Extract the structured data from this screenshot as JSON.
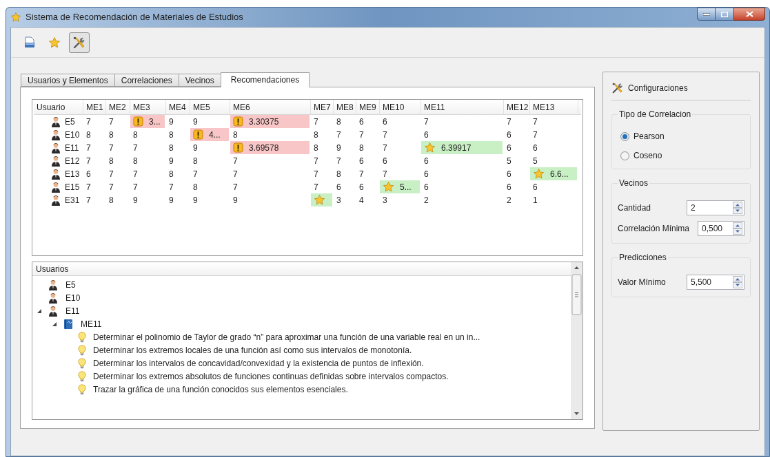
{
  "window": {
    "title": "Sistema de Recomendación de Materiales de Estudios"
  },
  "toolbar": {
    "buttons": [
      {
        "kind": "document",
        "selected": false
      },
      {
        "kind": "star",
        "selected": false
      },
      {
        "kind": "tools",
        "selected": true
      }
    ]
  },
  "tabs": [
    {
      "label": "Usuarios y Elementos",
      "selected": false
    },
    {
      "label": "Correlaciones",
      "selected": false
    },
    {
      "label": "Vecinos",
      "selected": false
    },
    {
      "label": "Recomendaciones",
      "selected": true
    }
  ],
  "table": {
    "columns": [
      "Usuario",
      "ME1",
      "ME2",
      "ME3",
      "ME4",
      "ME5",
      "ME6",
      "ME7",
      "ME8",
      "ME9",
      "ME10",
      "ME11",
      "ME12",
      "ME13"
    ],
    "rows": [
      {
        "cells": [
          {
            "kind": "user",
            "text": "E5"
          },
          {
            "kind": "value",
            "text": "7"
          },
          {
            "kind": "value",
            "text": "7"
          },
          {
            "kind": "warning",
            "text": "3..."
          },
          {
            "kind": "value",
            "text": "9"
          },
          {
            "kind": "value",
            "text": "9"
          },
          {
            "kind": "warning",
            "text": "3.30375"
          },
          {
            "kind": "value",
            "text": "7"
          },
          {
            "kind": "value",
            "text": "8"
          },
          {
            "kind": "value",
            "text": "6"
          },
          {
            "kind": "value",
            "text": "6"
          },
          {
            "kind": "value",
            "text": "7"
          },
          {
            "kind": "value",
            "text": "7"
          },
          {
            "kind": "value",
            "text": "7"
          }
        ]
      },
      {
        "cells": [
          {
            "kind": "user",
            "text": "E10"
          },
          {
            "kind": "value",
            "text": "8"
          },
          {
            "kind": "value",
            "text": "8"
          },
          {
            "kind": "value",
            "text": "8"
          },
          {
            "kind": "value",
            "text": "8"
          },
          {
            "kind": "warning",
            "text": "4..."
          },
          {
            "kind": "value",
            "text": "8"
          },
          {
            "kind": "value",
            "text": "8"
          },
          {
            "kind": "value",
            "text": "7"
          },
          {
            "kind": "value",
            "text": "7"
          },
          {
            "kind": "value",
            "text": "7"
          },
          {
            "kind": "value",
            "text": "6"
          },
          {
            "kind": "value",
            "text": "6"
          },
          {
            "kind": "value",
            "text": "7"
          }
        ]
      },
      {
        "cells": [
          {
            "kind": "user",
            "text": "E11"
          },
          {
            "kind": "value",
            "text": "7"
          },
          {
            "kind": "value",
            "text": "7"
          },
          {
            "kind": "value",
            "text": "7"
          },
          {
            "kind": "value",
            "text": "8"
          },
          {
            "kind": "value",
            "text": "9"
          },
          {
            "kind": "warning",
            "text": "3.69578"
          },
          {
            "kind": "value",
            "text": "8"
          },
          {
            "kind": "value",
            "text": "9"
          },
          {
            "kind": "value",
            "text": "8"
          },
          {
            "kind": "value",
            "text": "7"
          },
          {
            "kind": "recommended",
            "text": "6.39917"
          },
          {
            "kind": "value",
            "text": "6"
          },
          {
            "kind": "value",
            "text": "6"
          }
        ]
      },
      {
        "cells": [
          {
            "kind": "user",
            "text": "E12"
          },
          {
            "kind": "value",
            "text": "7"
          },
          {
            "kind": "value",
            "text": "8"
          },
          {
            "kind": "value",
            "text": "8"
          },
          {
            "kind": "value",
            "text": "9"
          },
          {
            "kind": "value",
            "text": "8"
          },
          {
            "kind": "value",
            "text": "7"
          },
          {
            "kind": "value",
            "text": "7"
          },
          {
            "kind": "value",
            "text": "7"
          },
          {
            "kind": "value",
            "text": "6"
          },
          {
            "kind": "value",
            "text": "6"
          },
          {
            "kind": "value",
            "text": "6"
          },
          {
            "kind": "value",
            "text": "5"
          },
          {
            "kind": "value",
            "text": "5"
          }
        ]
      },
      {
        "cells": [
          {
            "kind": "user",
            "text": "E13"
          },
          {
            "kind": "value",
            "text": "6"
          },
          {
            "kind": "value",
            "text": "7"
          },
          {
            "kind": "value",
            "text": "7"
          },
          {
            "kind": "value",
            "text": "8"
          },
          {
            "kind": "value",
            "text": "7"
          },
          {
            "kind": "value",
            "text": "7"
          },
          {
            "kind": "value",
            "text": "7"
          },
          {
            "kind": "value",
            "text": "8"
          },
          {
            "kind": "value",
            "text": "7"
          },
          {
            "kind": "value",
            "text": "7"
          },
          {
            "kind": "value",
            "text": "6"
          },
          {
            "kind": "value",
            "text": "6"
          },
          {
            "kind": "recommended",
            "text": "6.6..."
          }
        ]
      },
      {
        "cells": [
          {
            "kind": "user",
            "text": "E15"
          },
          {
            "kind": "value",
            "text": "7"
          },
          {
            "kind": "value",
            "text": "7"
          },
          {
            "kind": "value",
            "text": "7"
          },
          {
            "kind": "value",
            "text": "7"
          },
          {
            "kind": "value",
            "text": "8"
          },
          {
            "kind": "value",
            "text": "7"
          },
          {
            "kind": "value",
            "text": "7"
          },
          {
            "kind": "value",
            "text": "6"
          },
          {
            "kind": "value",
            "text": "6"
          },
          {
            "kind": "recommended",
            "text": "5..."
          },
          {
            "kind": "value",
            "text": "6"
          },
          {
            "kind": "value",
            "text": "6"
          },
          {
            "kind": "value",
            "text": "6"
          }
        ]
      },
      {
        "cells": [
          {
            "kind": "user",
            "text": "E31"
          },
          {
            "kind": "value",
            "text": "7"
          },
          {
            "kind": "value",
            "text": "8"
          },
          {
            "kind": "value",
            "text": "9"
          },
          {
            "kind": "value",
            "text": "9"
          },
          {
            "kind": "value",
            "text": "9"
          },
          {
            "kind": "value",
            "text": "9"
          },
          {
            "kind": "recommended"
          },
          {
            "kind": "value",
            "text": "3"
          },
          {
            "kind": "value",
            "text": "4"
          },
          {
            "kind": "value",
            "text": "3"
          },
          {
            "kind": "value",
            "text": "2"
          },
          {
            "kind": "value",
            "text": "2"
          },
          {
            "kind": "value",
            "text": "1"
          }
        ]
      }
    ]
  },
  "tree": {
    "header": "Usuarios",
    "items": [
      {
        "kind": "user",
        "label": "E5"
      },
      {
        "kind": "user",
        "label": "E10"
      },
      {
        "kind": "user",
        "label": "E11",
        "expanded": true,
        "children": [
          {
            "kind": "material",
            "label": "ME11",
            "expanded": true,
            "children": [
              {
                "kind": "objective",
                "label": "Determinar el polinomio de Taylor de grado “n” para aproximar una función de una variable real en un in..."
              },
              {
                "kind": "objective",
                "label": "Determinar los extremos locales de una función así como sus intervalos de monotonía."
              },
              {
                "kind": "objective",
                "label": "Determinar los intervalos de concavidad/convexidad y la existencia de puntos de inflexión."
              },
              {
                "kind": "objective",
                "label": "Determinar los extremos absolutos de funciones continuas definidas sobre intervalos compactos."
              },
              {
                "kind": "objective",
                "label": "Trazar la gráfica de una función conocidos sus elementos esenciales."
              }
            ]
          }
        ]
      }
    ]
  },
  "settings": {
    "title": "Configuraciones",
    "correlation": {
      "title": "Tipo de Correlacion",
      "options": [
        {
          "label": "Pearson",
          "selected": true
        },
        {
          "label": "Coseno",
          "selected": false
        }
      ]
    },
    "neighbors": {
      "title": "Vecinos",
      "fields": [
        {
          "label": "Cantidad",
          "value": "2"
        },
        {
          "label": "Correlación Mínima",
          "value": "0,500"
        }
      ]
    },
    "predictions": {
      "title": "Predicciones",
      "fields": [
        {
          "label": "Valor Mínimo",
          "value": "5,500"
        }
      ]
    }
  }
}
